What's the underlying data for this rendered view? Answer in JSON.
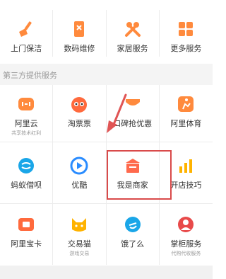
{
  "top_services": [
    {
      "label": "上门保洁",
      "icon": "broom-icon"
    },
    {
      "label": "数码维修",
      "icon": "phone-repair-icon"
    },
    {
      "label": "家居服务",
      "icon": "tools-icon"
    },
    {
      "label": "更多服务",
      "icon": "grid-icon"
    }
  ],
  "section": {
    "title": "第三方提供服务"
  },
  "third_party_row1": [
    {
      "label": "阿里云",
      "sub": "共享技术红利",
      "icon": "cloud-icon"
    },
    {
      "label": "淘票票",
      "sub": "",
      "icon": "ticket-mascot-icon"
    },
    {
      "label": "口碑抢优惠",
      "sub": "",
      "icon": "koubei-icon"
    },
    {
      "label": "阿里体育",
      "sub": "",
      "icon": "sports-icon"
    }
  ],
  "third_party_row2": [
    {
      "label": "蚂蚁借呗",
      "sub": "",
      "icon": "ant-loan-icon"
    },
    {
      "label": "优酷",
      "sub": "",
      "icon": "youku-icon"
    },
    {
      "label": "我是商家",
      "sub": "",
      "icon": "shop-icon"
    },
    {
      "label": "开店技巧",
      "sub": "",
      "icon": "chart-icon"
    }
  ],
  "third_party_row3": [
    {
      "label": "阿里宝卡",
      "sub": "",
      "icon": "sim-card-icon"
    },
    {
      "label": "交易猫",
      "sub": "游戏交易",
      "icon": "cat-icon"
    },
    {
      "label": "饿了么",
      "sub": "",
      "icon": "eleme-icon"
    },
    {
      "label": "掌柜服务",
      "sub": "代购代收服务",
      "icon": "shopkeeper-icon"
    }
  ],
  "colors": {
    "accent": "#ff8a3d",
    "highlight": "#d94a4a",
    "youku": "#2a8cff",
    "ant": "#1aa6e8"
  }
}
